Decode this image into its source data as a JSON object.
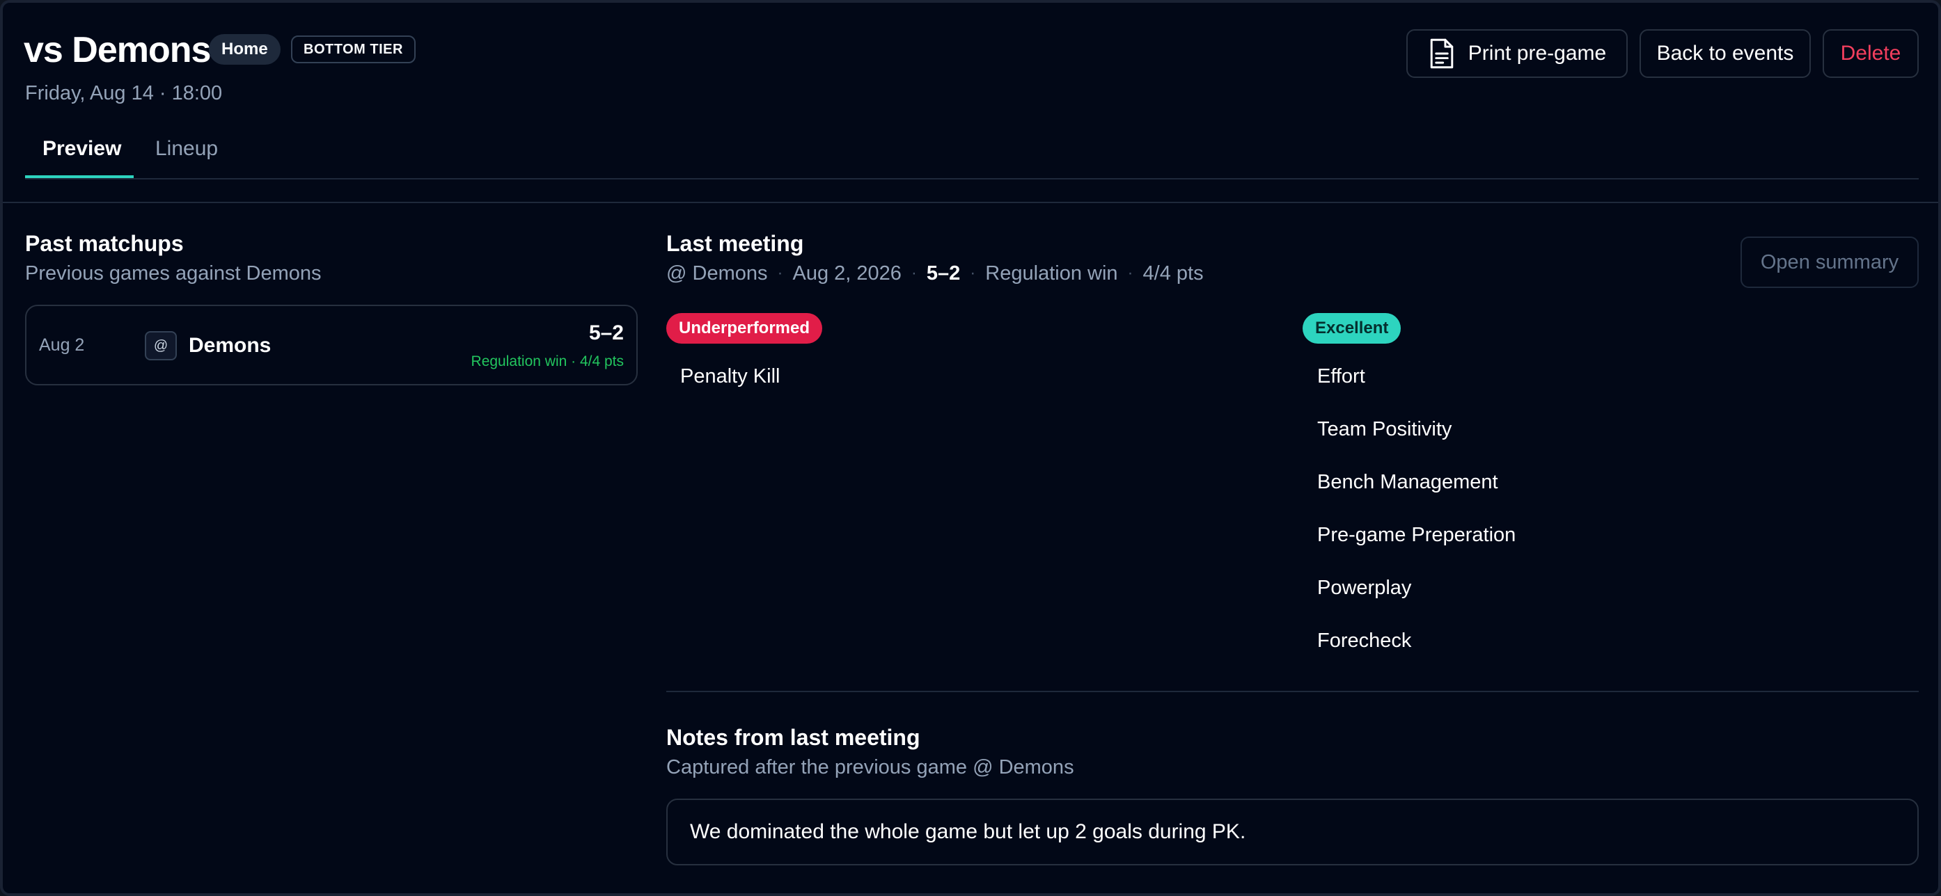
{
  "header": {
    "title": "vs Demons",
    "home_badge": "Home",
    "tier_badge": "BOTTOM TIER",
    "datetime": "Friday, Aug 14 · 18:00",
    "buttons": {
      "print": "Print pre-game",
      "back": "Back to events",
      "delete": "Delete"
    }
  },
  "tabs": [
    {
      "label": "Preview",
      "active": true
    },
    {
      "label": "Lineup",
      "active": false
    }
  ],
  "past_matchups": {
    "title": "Past matchups",
    "subtitle": "Previous games against Demons",
    "games": [
      {
        "date": "Aug 2",
        "venue_marker": "@",
        "opponent": "Demons",
        "score": "5–2",
        "result": "Regulation win · 4/4 pts"
      }
    ]
  },
  "last_meeting": {
    "title": "Last meeting",
    "opponent": "@ Demons",
    "date": "Aug 2, 2026",
    "score": "5–2",
    "result": "Regulation win",
    "points": "4/4 pts",
    "separator": "·",
    "open_summary_label": "Open summary",
    "underperformed": {
      "label": "Underperformed",
      "color": "#e11d48",
      "items": [
        "Penalty Kill"
      ]
    },
    "excellent": {
      "label": "Excellent",
      "color": "#2dd4bf",
      "items": [
        "Effort",
        "Team Positivity",
        "Bench Management",
        "Pre-game Preperation",
        "Powerplay",
        "Forecheck"
      ]
    }
  },
  "notes": {
    "title": "Notes from last meeting",
    "subtitle": "Captured after the previous game @ Demons",
    "text": "We dominated the whole game but let up 2 goals during PK."
  },
  "theme": {
    "background": "#020817",
    "accent": "#2dd4bf",
    "danger": "#f43f5e",
    "win": "#22c55e"
  }
}
